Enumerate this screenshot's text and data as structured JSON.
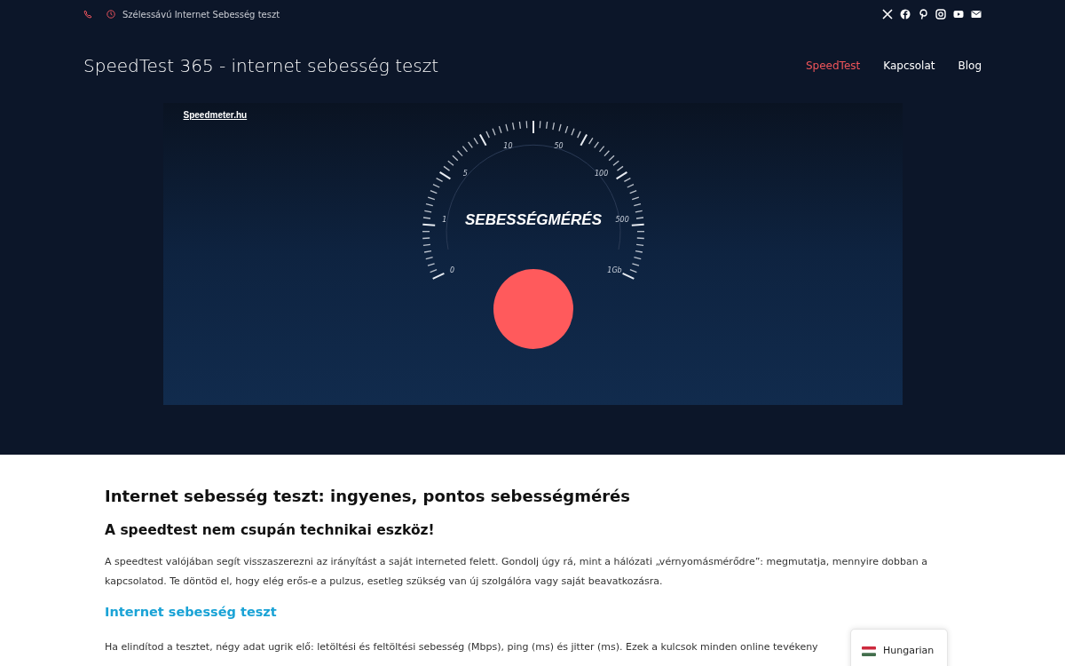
{
  "topbar": {
    "info": "Szélessávú Internet Sebesség teszt"
  },
  "header": {
    "title": "SpeedTest 365 - internet sebesség teszt",
    "nav": [
      {
        "label": "SpeedTest",
        "selected": true
      },
      {
        "label": "Kapcsolat",
        "selected": false
      },
      {
        "label": "Blog",
        "selected": false
      }
    ]
  },
  "embed": {
    "credit_link": "Speedmeter.hu",
    "gauge_title": "SEBESSÉGMÉRÉS",
    "scale_labels": [
      "0",
      "1",
      "5",
      "10",
      "50",
      "100",
      "500",
      "1Gb"
    ]
  },
  "article": {
    "heading": "Internet sebesség teszt: ingyenes, pontos sebességmérés",
    "subheading": "A speedtest nem csupán technikai eszköz!",
    "paragraph": "A speedtest valójában segít visszaszerezni az irányítást a saját interneted felett. Gondolj úgy rá, mint a hálózati „vérnyomásmérődre”: megmutatja, mennyire dobban a kapcsolatod. Te döntöd el, hogy elég erős-e a pulzus, esetleg szükség van új szolgálóra vagy saját beavatkozásra.",
    "section_heading": "Internet sebesség teszt",
    "paragraph_2": "Ha elindítod a tesztet, négy adat ugrik elő: letöltési és feltöltési sebesség (Mbps), ping (ms) és jitter (ms). Ezek a kulcsok minden online tevékeny"
  },
  "language": {
    "label": "Hungarian"
  }
}
